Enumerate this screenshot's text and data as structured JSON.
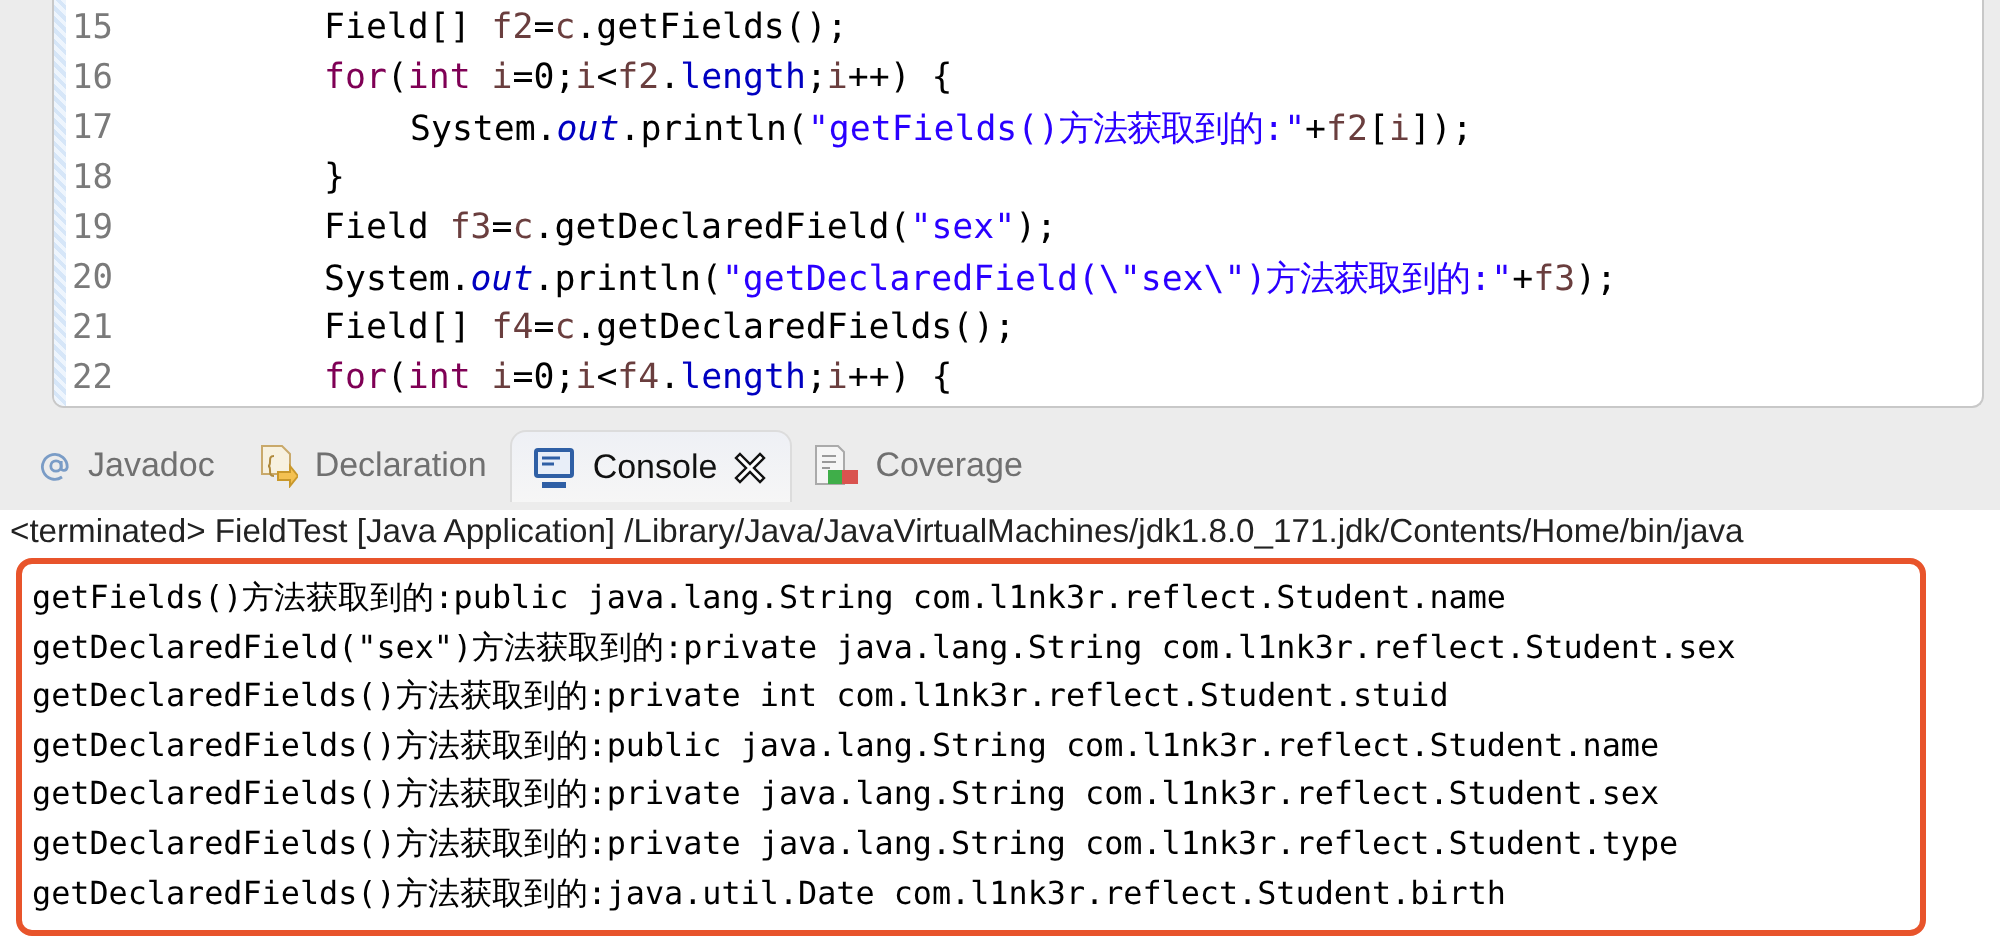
{
  "editor": {
    "lines": [
      {
        "number": "15",
        "tokens": [
          {
            "kind": "plain",
            "text": "Field[] "
          },
          {
            "kind": "var",
            "text": "f2"
          },
          {
            "kind": "plain",
            "text": "="
          },
          {
            "kind": "var",
            "text": "c"
          },
          {
            "kind": "plain",
            "text": ".getFields();"
          }
        ]
      },
      {
        "number": "16",
        "tokens": [
          {
            "kind": "keyword",
            "text": "for"
          },
          {
            "kind": "plain",
            "text": "("
          },
          {
            "kind": "keyword",
            "text": "int"
          },
          {
            "kind": "var",
            "text": " i"
          },
          {
            "kind": "plain",
            "text": "=0;"
          },
          {
            "kind": "var",
            "text": "i"
          },
          {
            "kind": "plain",
            "text": "<"
          },
          {
            "kind": "var",
            "text": "f2"
          },
          {
            "kind": "plain",
            "text": "."
          },
          {
            "kind": "field",
            "text": "length"
          },
          {
            "kind": "plain",
            "text": ";"
          },
          {
            "kind": "var",
            "text": "i"
          },
          {
            "kind": "plain",
            "text": "++) {"
          }
        ],
        "children": [
          {
            "number": "17",
            "tokens": [
              {
                "kind": "plain",
                "text": "System."
              },
              {
                "kind": "static",
                "text": "out"
              },
              {
                "kind": "plain",
                "text": ".println("
              },
              {
                "kind": "string",
                "text": "\"getFields()方法获取到的:\""
              },
              {
                "kind": "plain",
                "text": "+"
              },
              {
                "kind": "var",
                "text": "f2"
              },
              {
                "kind": "plain",
                "text": "["
              },
              {
                "kind": "var",
                "text": "i"
              },
              {
                "kind": "plain",
                "text": "]);"
              }
            ]
          }
        ]
      },
      {
        "number": "18",
        "tokens": [
          {
            "kind": "plain",
            "text": "}"
          }
        ]
      },
      {
        "number": "19",
        "tokens": [
          {
            "kind": "plain",
            "text": "Field "
          },
          {
            "kind": "var",
            "text": "f3"
          },
          {
            "kind": "plain",
            "text": "="
          },
          {
            "kind": "var",
            "text": "c"
          },
          {
            "kind": "plain",
            "text": ".getDeclaredField("
          },
          {
            "kind": "string",
            "text": "\"sex\""
          },
          {
            "kind": "plain",
            "text": ");"
          }
        ]
      },
      {
        "number": "20",
        "tokens": [
          {
            "kind": "plain",
            "text": "System."
          },
          {
            "kind": "static",
            "text": "out"
          },
          {
            "kind": "plain",
            "text": ".println("
          },
          {
            "kind": "string",
            "text": "\"getDeclaredField(\\\"sex\\\")方法获取到的:\""
          },
          {
            "kind": "plain",
            "text": "+"
          },
          {
            "kind": "var",
            "text": "f3"
          },
          {
            "kind": "plain",
            "text": ");"
          }
        ]
      },
      {
        "number": "21",
        "tokens": [
          {
            "kind": "plain",
            "text": "Field[] "
          },
          {
            "kind": "var",
            "text": "f4"
          },
          {
            "kind": "plain",
            "text": "="
          },
          {
            "kind": "var",
            "text": "c"
          },
          {
            "kind": "plain",
            "text": ".getDeclaredFields();"
          }
        ]
      },
      {
        "number": "22",
        "tokens": [
          {
            "kind": "keyword",
            "text": "for"
          },
          {
            "kind": "plain",
            "text": "("
          },
          {
            "kind": "keyword",
            "text": "int"
          },
          {
            "kind": "var",
            "text": " i"
          },
          {
            "kind": "plain",
            "text": "=0;"
          },
          {
            "kind": "var",
            "text": "i"
          },
          {
            "kind": "plain",
            "text": "<"
          },
          {
            "kind": "var",
            "text": "f4"
          },
          {
            "kind": "plain",
            "text": "."
          },
          {
            "kind": "field",
            "text": "length"
          },
          {
            "kind": "plain",
            "text": ";"
          },
          {
            "kind": "var",
            "text": "i"
          },
          {
            "kind": "plain",
            "text": "++) {"
          }
        ]
      }
    ]
  },
  "tabs": [
    {
      "label": "Javadoc",
      "selected": false
    },
    {
      "label": "Declaration",
      "selected": false
    },
    {
      "label": "Console",
      "selected": true
    },
    {
      "label": "Coverage",
      "selected": false
    }
  ],
  "console": {
    "status": "<terminated> FieldTest [Java Application] /Library/Java/JavaVirtualMachines/jdk1.8.0_171.jdk/Contents/Home/bin/java",
    "output": [
      "getFields()方法获取到的:public java.lang.String com.l1nk3r.reflect.Student.name",
      "getDeclaredField(\"sex\")方法获取到的:private java.lang.String com.l1nk3r.reflect.Student.sex",
      "getDeclaredFields()方法获取到的:private int com.l1nk3r.reflect.Student.stuid",
      "getDeclaredFields()方法获取到的:public java.lang.String com.l1nk3r.reflect.Student.name",
      "getDeclaredFields()方法获取到的:private java.lang.String com.l1nk3r.reflect.Student.sex",
      "getDeclaredFields()方法获取到的:private java.lang.String com.l1nk3r.reflect.Student.type",
      "getDeclaredFields()方法获取到的:java.util.Date com.l1nk3r.reflect.Student.birth"
    ]
  }
}
